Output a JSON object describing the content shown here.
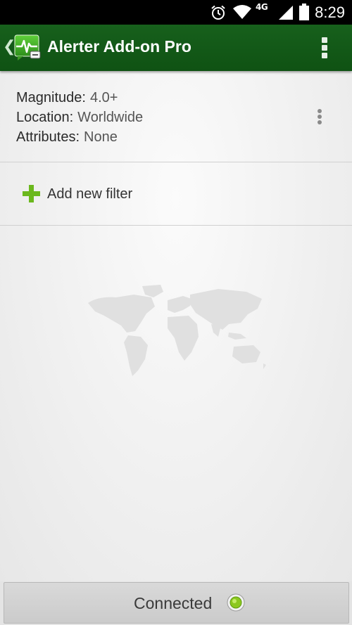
{
  "status_bar": {
    "time": "8:29",
    "network_label": "4G",
    "icons": [
      "alarm-icon",
      "wifi-icon",
      "signal-icon",
      "battery-icon"
    ]
  },
  "action_bar": {
    "title": "Alerter Add-on Pro",
    "app_icon": "earthquake-alerter-icon",
    "menu_icon": "overflow-menu-icon",
    "color": "#17601c"
  },
  "filter": {
    "magnitude_label": "Magnitude:",
    "magnitude_value": "4.0+",
    "location_label": "Location:",
    "location_value": "Worldwide",
    "attributes_label": "Attributes:",
    "attributes_value": "None",
    "menu_icon": "overflow-menu-icon"
  },
  "add_filter": {
    "label": "Add new filter",
    "icon": "plus-icon",
    "icon_color": "#6bb81d"
  },
  "bottom": {
    "status_label": "Connected",
    "status_icon": "connection-status-icon",
    "status_color": "#8cc820"
  }
}
